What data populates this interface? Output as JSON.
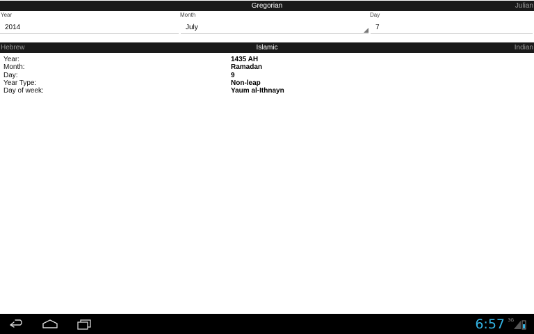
{
  "top_tabs": {
    "active": "Gregorian",
    "right": "Julian"
  },
  "gregorian_inputs": {
    "year_label": "Year",
    "year_value": "2014",
    "month_label": "Month",
    "month_value": "July",
    "day_label": "Day",
    "day_value": "7"
  },
  "calendar_tabs": {
    "left": "Hebrew",
    "active": "Islamic",
    "right": "Indian"
  },
  "results": {
    "rows": [
      {
        "label": "Year:",
        "value": "1435 AH"
      },
      {
        "label": "Month:",
        "value": "Ramadan"
      },
      {
        "label": "Day:",
        "value": "9"
      },
      {
        "label": "Year Type:",
        "value": "Non-leap"
      },
      {
        "label": "Day of week:",
        "value": "Yaum al-Ithnayn"
      }
    ]
  },
  "status": {
    "clock": "6:57",
    "signal_label": "3G",
    "accent_color": "#33b5e5"
  },
  "icons": {
    "back": "back-icon",
    "home": "home-icon",
    "recents": "recent-apps-icon",
    "signal": "signal-icon",
    "battery": "battery-icon"
  }
}
